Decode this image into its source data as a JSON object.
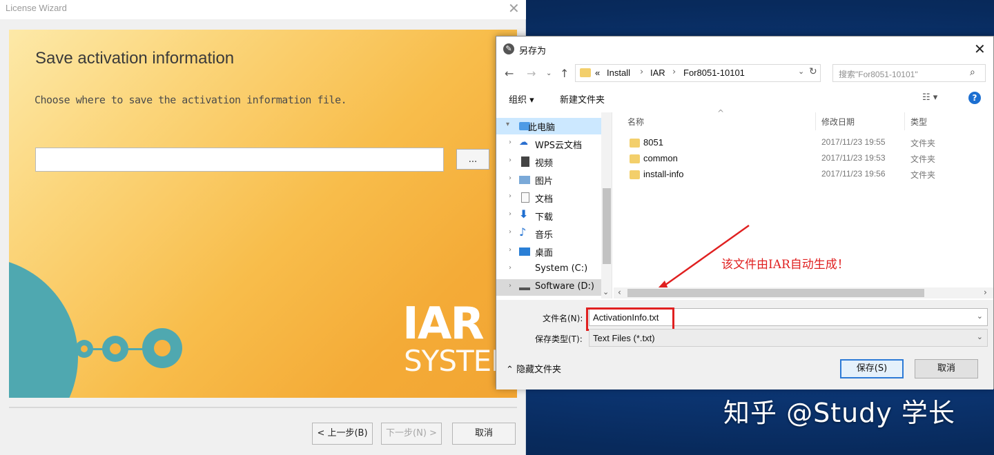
{
  "wizard": {
    "title": "License Wizard",
    "heading": "Save activation information",
    "description": "Choose where to save the activation information file.",
    "path_value": "",
    "browse_label": "...",
    "logo_top": "IAR",
    "logo_bottom": "SYSTEMS",
    "buttons": {
      "back": "< 上一步(B)",
      "next": "下一步(N) >",
      "cancel": "取消"
    }
  },
  "dialog": {
    "title": "另存为",
    "breadcrumb": [
      "«",
      "Install",
      "IAR",
      "For8051-10101"
    ],
    "search_placeholder": "搜索\"For8051-10101\"",
    "toolbar": {
      "organize": "组织 ▾",
      "new_folder": "新建文件夹"
    },
    "nav_tree": [
      {
        "label": "此电脑",
        "icon": "computer-icon",
        "selected": true
      },
      {
        "label": "WPS云文档",
        "icon": "cloud-icon"
      },
      {
        "label": "视频",
        "icon": "video-icon"
      },
      {
        "label": "图片",
        "icon": "picture-icon"
      },
      {
        "label": "文档",
        "icon": "document-icon"
      },
      {
        "label": "下载",
        "icon": "download-icon"
      },
      {
        "label": "音乐",
        "icon": "music-icon"
      },
      {
        "label": "桌面",
        "icon": "desktop-icon"
      },
      {
        "label": "System (C:)",
        "icon": "drive-icon"
      },
      {
        "label": "Software (D:)",
        "icon": "drive-icon"
      }
    ],
    "columns": {
      "name": "名称",
      "date": "修改日期",
      "type": "类型"
    },
    "files": [
      {
        "name": "8051",
        "date": "2017/11/23 19:55",
        "type": "文件夹"
      },
      {
        "name": "common",
        "date": "2017/11/23 19:53",
        "type": "文件夹"
      },
      {
        "name": "install-info",
        "date": "2017/11/23 19:56",
        "type": "文件夹"
      }
    ],
    "annotation": "该文件由IAR自动生成！",
    "filename_label": "文件名(N):",
    "filename_value": "ActivationInfo.txt",
    "filetype_label": "保存类型(T):",
    "filetype_value": "Text Files (*.txt)",
    "hide_folders": "隐藏文件夹",
    "save_button": "保存(S)",
    "cancel_button": "取消"
  },
  "watermark": "知乎 @Study 学长",
  "colors": {
    "accent": "#2c7ad6",
    "annotation_red": "#e02020",
    "banner_orange": "#f4ab37",
    "logo_teal": "#4fa8b0"
  }
}
